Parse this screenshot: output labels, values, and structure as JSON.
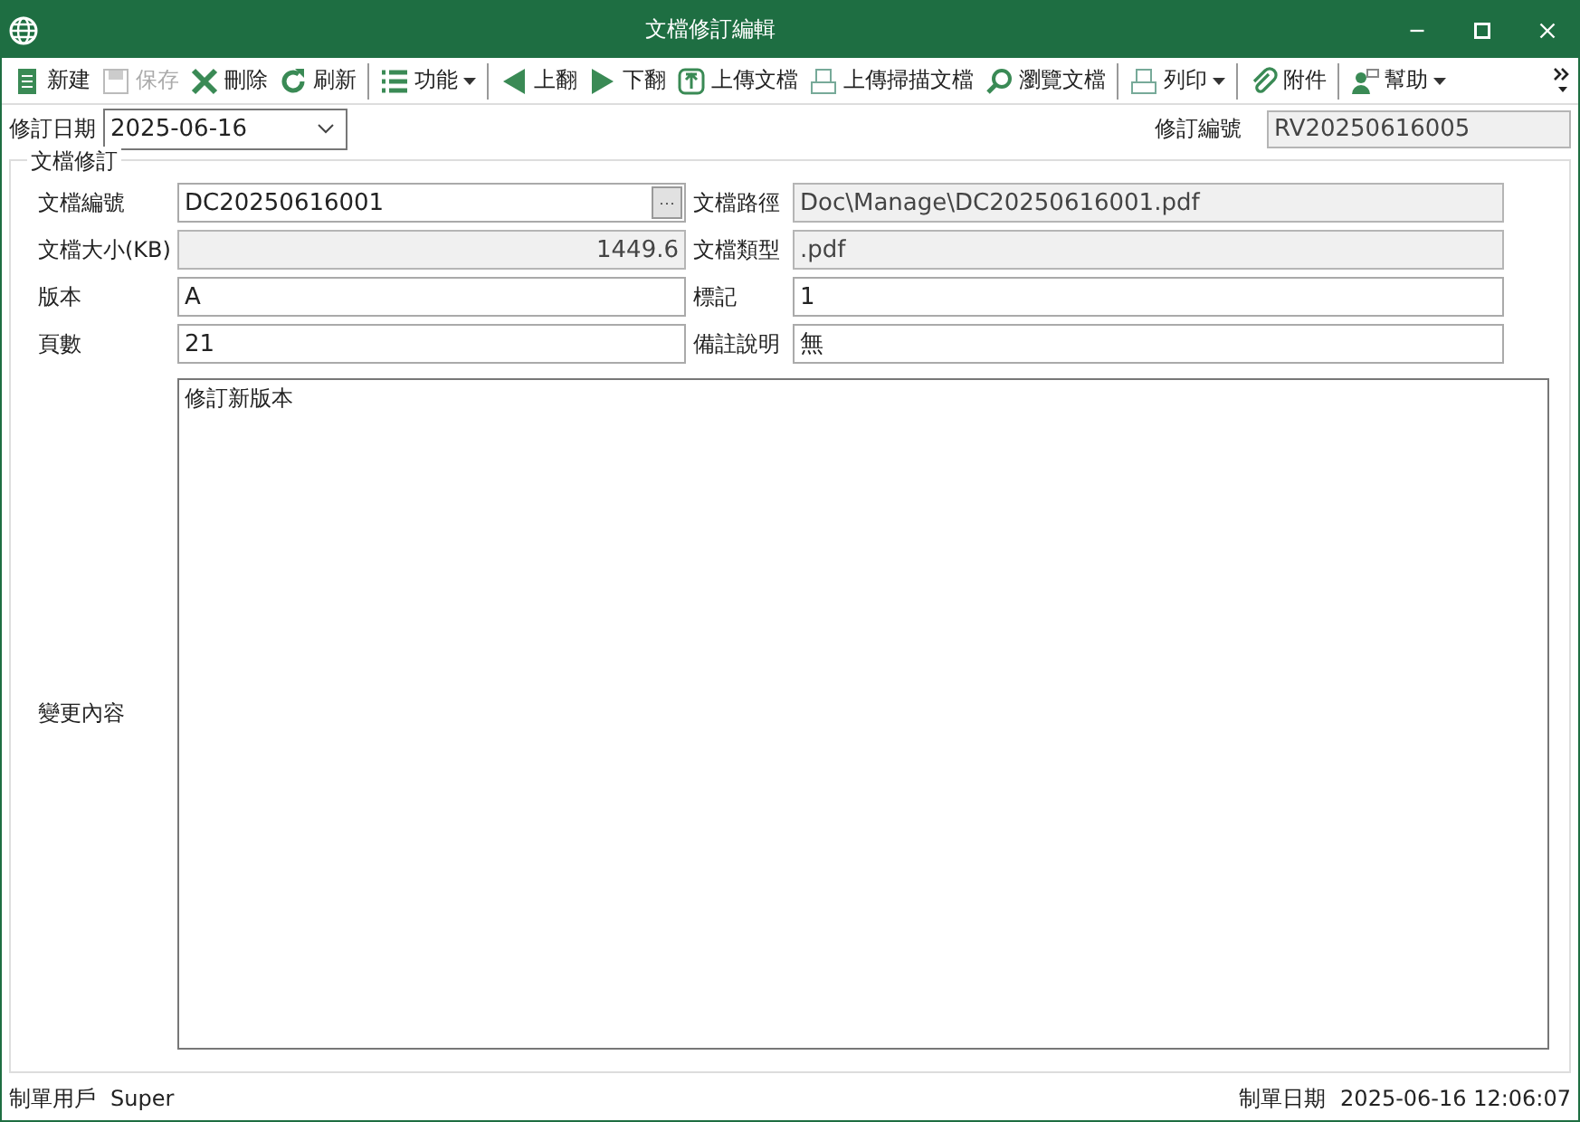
{
  "window": {
    "title": "文檔修訂編輯"
  },
  "toolbar": [
    {
      "kind": "doc",
      "label": "新建",
      "disabled": false,
      "dropdown": false,
      "sep_after": false
    },
    {
      "kind": "save",
      "label": "保存",
      "disabled": true,
      "dropdown": false,
      "sep_after": false
    },
    {
      "kind": "delete",
      "label": "刪除",
      "disabled": false,
      "dropdown": false,
      "sep_after": false
    },
    {
      "kind": "refresh",
      "label": "刷新",
      "disabled": false,
      "dropdown": false,
      "sep_after": true
    },
    {
      "kind": "list",
      "label": "功能",
      "disabled": false,
      "dropdown": true,
      "sep_after": true
    },
    {
      "kind": "prev",
      "label": "上翻",
      "disabled": false,
      "dropdown": false,
      "sep_after": false
    },
    {
      "kind": "next",
      "label": "下翻",
      "disabled": false,
      "dropdown": false,
      "sep_after": false
    },
    {
      "kind": "upload",
      "label": "上傳文檔",
      "disabled": false,
      "dropdown": false,
      "sep_after": false
    },
    {
      "kind": "print",
      "label": "上傳掃描文檔",
      "disabled": false,
      "dropdown": false,
      "sep_after": false
    },
    {
      "kind": "search",
      "label": "瀏覽文檔",
      "disabled": false,
      "dropdown": false,
      "sep_after": true
    },
    {
      "kind": "print",
      "label": "列印",
      "disabled": false,
      "dropdown": true,
      "sep_after": true
    },
    {
      "kind": "clip",
      "label": "附件",
      "disabled": false,
      "dropdown": false,
      "sep_after": true
    },
    {
      "kind": "help",
      "label": "幫助",
      "disabled": false,
      "dropdown": true,
      "sep_after": false
    }
  ],
  "header": {
    "date_label": "修訂日期",
    "date_value": "2025-06-16",
    "number_label": "修訂編號",
    "number_value": "RV20250616005"
  },
  "group": {
    "title": "文檔修訂",
    "fields": [
      {
        "label": "文檔編號",
        "value": "DC20250616001",
        "readonly": false,
        "right_aligned": false,
        "browse": "···"
      },
      {
        "label": "文檔路徑",
        "value": "Doc\\Manage\\DC20250616001.pdf",
        "readonly": true,
        "right_aligned": false
      },
      {
        "label": "文檔大小(KB)",
        "value": "1449.6",
        "readonly": true,
        "right_aligned": true
      },
      {
        "label": "文檔類型",
        "value": ".pdf",
        "readonly": true,
        "right_aligned": false
      },
      {
        "label": "版本",
        "value": "A",
        "readonly": false,
        "right_aligned": false
      },
      {
        "label": "標記",
        "value": "1",
        "readonly": false,
        "right_aligned": false
      },
      {
        "label": "頁數",
        "value": "21",
        "readonly": false,
        "right_aligned": false
      },
      {
        "label": "備註說明",
        "value": "無",
        "readonly": false,
        "right_aligned": false
      }
    ],
    "changes": {
      "label": "變更內容",
      "value": "修訂新版本"
    }
  },
  "status_bar": {
    "user_label": "制單用戶",
    "user": "Super",
    "date_label": "制單日期",
    "date": "2025-06-16 12:06:07"
  }
}
